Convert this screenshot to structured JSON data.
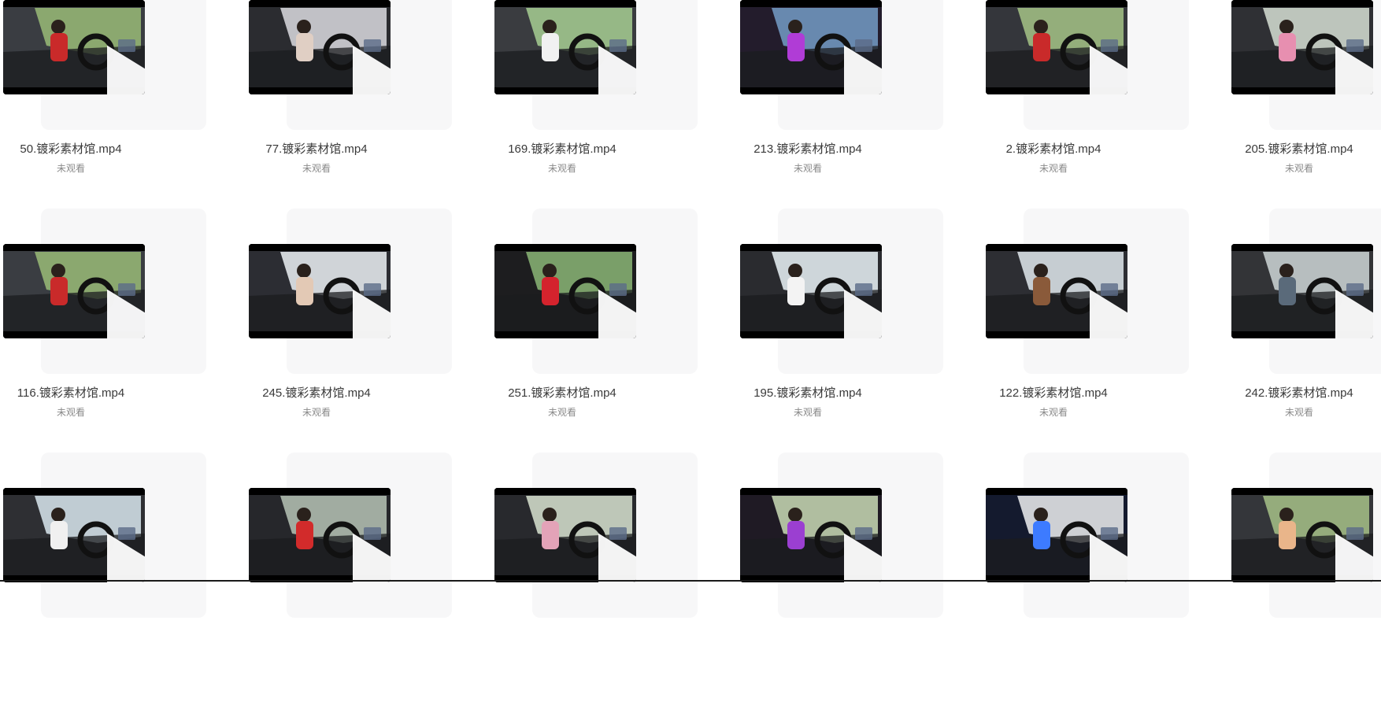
{
  "files": [
    {
      "name": "50.镀彩素材馆.mp4",
      "status": "未观看",
      "scene": {
        "sky": "#8fae72",
        "cabin": "#3a3d42",
        "accent": "#c92a2a"
      }
    },
    {
      "name": "77.镀彩素材馆.mp4",
      "status": "未观看",
      "scene": {
        "sky": "#c9c9cf",
        "cabin": "#2b2c30",
        "accent": "#e0cfc4"
      }
    },
    {
      "name": "169.镀彩素材馆.mp4",
      "status": "未观看",
      "scene": {
        "sky": "#9bbf8a",
        "cabin": "#3a3c40",
        "accent": "#f1f1f1"
      }
    },
    {
      "name": "213.镀彩素材馆.mp4",
      "status": "未观看",
      "scene": {
        "sky": "#6d8fb6",
        "cabin": "#231c2c",
        "accent": "#b03cd6"
      }
    },
    {
      "name": "2.镀彩素材馆.mp4",
      "status": "未观看",
      "scene": {
        "sky": "#9ab57e",
        "cabin": "#34363b",
        "accent": "#c92a2a"
      }
    },
    {
      "name": "205.镀彩素材馆.mp4",
      "status": "未观看",
      "scene": {
        "sky": "#c5cdc4",
        "cabin": "#2f3034",
        "accent": "#e78fb0"
      }
    },
    {
      "name": "116.镀彩素材馆.mp4",
      "status": "未观看",
      "scene": {
        "sky": "#8fae72",
        "cabin": "#3a3d42",
        "accent": "#c92a2a"
      }
    },
    {
      "name": "245.镀彩素材馆.mp4",
      "status": "未观看",
      "scene": {
        "sky": "#d9dde2",
        "cabin": "#2c2d33",
        "accent": "#e3c9b5"
      }
    },
    {
      "name": "251.镀彩素材馆.mp4",
      "status": "未观看",
      "scene": {
        "sky": "#7fa66e",
        "cabin": "#1d1d1f",
        "accent": "#d4232d"
      }
    },
    {
      "name": "195.镀彩素材馆.mp4",
      "status": "未观看",
      "scene": {
        "sky": "#d7dfe4",
        "cabin": "#2a2b2f",
        "accent": "#f3f3f3"
      }
    },
    {
      "name": "122.镀彩素材馆.mp4",
      "status": "未观看",
      "scene": {
        "sky": "#cfd6db",
        "cabin": "#2d2e33",
        "accent": "#8a5a3a"
      }
    },
    {
      "name": "242.镀彩素材馆.mp4",
      "status": "未观看",
      "scene": {
        "sky": "#bfc6c6",
        "cabin": "#333437",
        "accent": "#5a6a7a"
      }
    },
    {
      "name": "",
      "status": "",
      "scene": {
        "sky": "#c8d5dc",
        "cabin": "#2e2f33",
        "accent": "#f0f0f0"
      }
    },
    {
      "name": "",
      "status": "",
      "scene": {
        "sky": "#a8b3a8",
        "cabin": "#26272b",
        "accent": "#d22b2b"
      }
    },
    {
      "name": "",
      "status": "",
      "scene": {
        "sky": "#c6d0c0",
        "cabin": "#28292d",
        "accent": "#e3a3b8"
      }
    },
    {
      "name": "",
      "status": "",
      "scene": {
        "sky": "#b8c7a8",
        "cabin": "#1f1a24",
        "accent": "#9b3fd1"
      }
    },
    {
      "name": "",
      "status": "",
      "scene": {
        "sky": "#d8dadd",
        "cabin": "#141a2e",
        "accent": "#3d7bff"
      }
    },
    {
      "name": "",
      "status": "",
      "scene": {
        "sky": "#9bb37f",
        "cabin": "#34363a",
        "accent": "#e9b58a"
      }
    }
  ]
}
